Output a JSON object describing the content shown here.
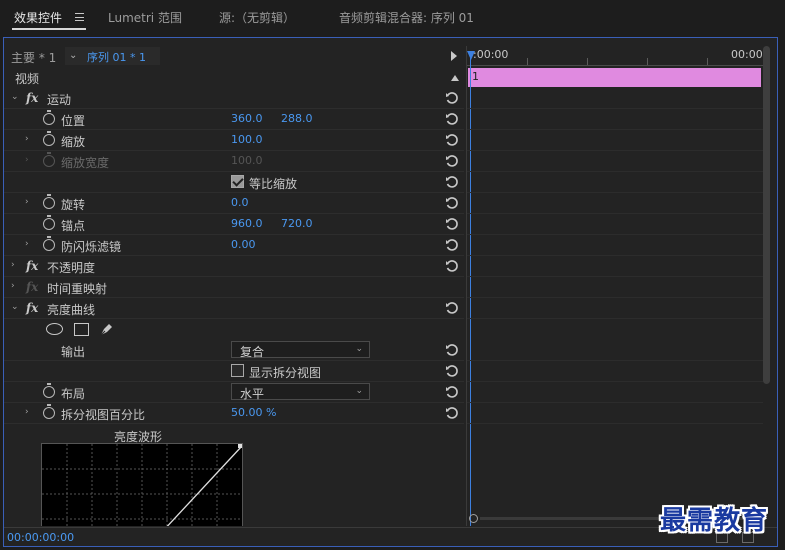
{
  "tabs": [
    {
      "label": "效果控件",
      "active": true
    },
    {
      "label": "Lumetri 范围",
      "active": false
    },
    {
      "label": "源:（无剪辑）",
      "active": false
    },
    {
      "label": "音频剪辑混合器: 序列 01",
      "active": false
    }
  ],
  "source_bar": {
    "main_label": "主要 * 1",
    "sequence_label": "序列 01 * 1"
  },
  "section_video": "视频",
  "effects": {
    "motion": {
      "name": "运动",
      "position": {
        "label": "位置",
        "x": "360.0",
        "y": "288.0"
      },
      "scale": {
        "label": "缩放",
        "value": "100.0"
      },
      "scale_width": {
        "label": "缩放宽度",
        "value": "100.0"
      },
      "uniform_scale": {
        "label": "等比缩放",
        "checked": true
      },
      "rotation": {
        "label": "旋转",
        "value": "0.0"
      },
      "anchor": {
        "label": "锚点",
        "x": "960.0",
        "y": "720.0"
      },
      "anti_flicker": {
        "label": "防闪烁滤镜",
        "value": "0.00"
      }
    },
    "opacity": {
      "name": "不透明度"
    },
    "time_remap": {
      "name": "时间重映射"
    },
    "luma_curve": {
      "name": "亮度曲线",
      "output": {
        "label": "输出",
        "value": "复合"
      },
      "split_view": {
        "label": "显示拆分视图",
        "checked": false
      },
      "layout": {
        "label": "布局",
        "value": "水平"
      },
      "split_percent": {
        "label": "拆分视图百分比",
        "value": "50.00 %"
      },
      "waveform_title": "亮度波形"
    }
  },
  "timeline": {
    "start_tc": ":00:00",
    "end_tc": "00:00",
    "clip_label": "1",
    "clip_color": "#e08ae0",
    "playhead_color": "#3d80e0"
  },
  "bottom_timecode": "00:00:00:00",
  "watermark": "最需教育",
  "colors": {
    "accent_blue": "#4a98f0",
    "panel_border": "#3a5fb8"
  }
}
